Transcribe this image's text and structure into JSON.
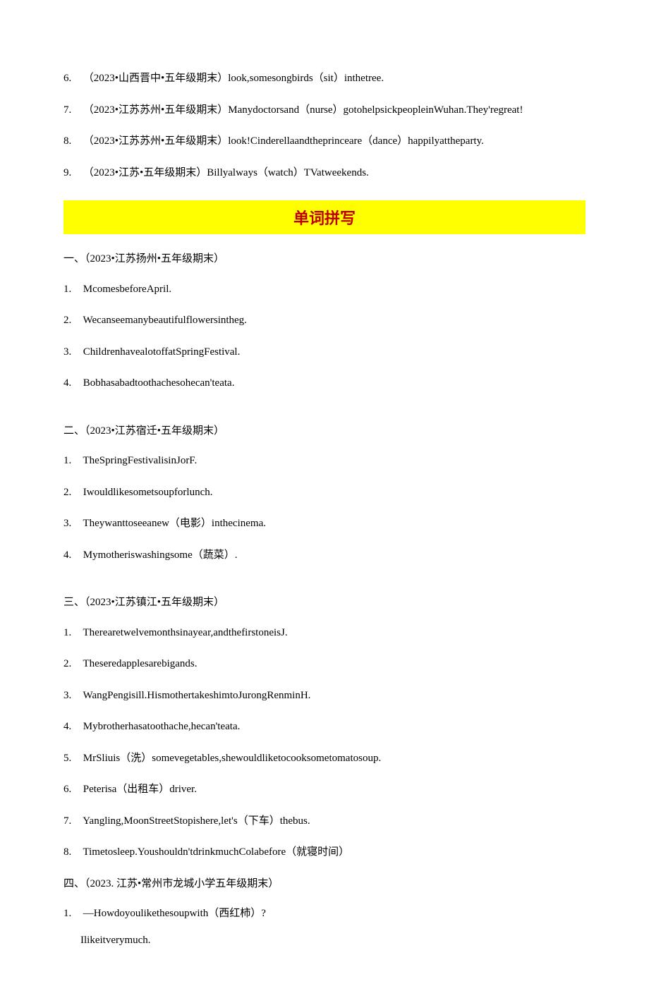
{
  "top_items": [
    {
      "num": "6.",
      "text": "（2023•山西晋中•五年级期末）look,somesongbirds（sit）inthetree."
    },
    {
      "num": "7.",
      "text": "（2023•江苏苏州•五年级期末）Manydoctorsand（nurse）gotohelpsickpeopleinWuhan.They'regreat!"
    },
    {
      "num": "8.",
      "text": "（2023•江苏苏州•五年级期末）look!Cinderellaandtheprinceare（dance）happilyattheparty."
    },
    {
      "num": "9.",
      "text": "（2023•江苏•五年级期末）Billyalways（watch）TVatweekends."
    }
  ],
  "banner": "单词拼写",
  "groups": [
    {
      "title": "一、（2023•江苏扬州•五年级期末）",
      "items": [
        {
          "num": "1.",
          "text": "McomesbeforeApril."
        },
        {
          "num": "2.",
          "text": "Wecanseemanybeautifulflowersintheg."
        },
        {
          "num": "3.",
          "text": "ChildrenhavealotoffatSpringFestival."
        },
        {
          "num": "4.",
          "text": "Bobhasabadtoothachesohecan'teata."
        }
      ]
    },
    {
      "title": "二、（2023•江苏宿迁•五年级期末）",
      "items": [
        {
          "num": "1.",
          "text": "TheSpringFestivalisinJorF."
        },
        {
          "num": "2.",
          "text": "Iwouldlikesometsoupforlunch."
        },
        {
          "num": "3.",
          "text": "Theywanttoseeanew（电影）inthecinema."
        },
        {
          "num": "4.",
          "text": "Mymotheriswashingsome（蔬菜）."
        }
      ]
    },
    {
      "title": "三、（2023•江苏镇江•五年级期末）",
      "items": [
        {
          "num": "1.",
          "text": "Therearetwelvemonthsinayear,andthefirstoneisJ."
        },
        {
          "num": "2.",
          "text": "Theseredapplesarebigands."
        },
        {
          "num": "3.",
          "text": "WangPengisill.HismothertakeshimtoJurongRenminH."
        },
        {
          "num": "4.",
          "text": "Mybrotherhasatoothache,hecan'teata."
        },
        {
          "num": "5.",
          "text": "MrSliuis（洗）somevegetables,shewouldliketocooksometomatosoup."
        },
        {
          "num": "6.",
          "text": "Peterisa（出租车）driver."
        },
        {
          "num": "7.",
          "text": "Yangling,MoonStreetStopishere,let's（下车）thebus."
        },
        {
          "num": "8.",
          "text": "Timetosleep.Youshouldn'tdrinkmuchColabefore（就寝时间）"
        }
      ]
    },
    {
      "title": "四、（2023. 江苏•常州市龙城小学五年级期末）",
      "items": [
        {
          "num": "1.",
          "text": "—Howdoyoulikethesoupwith（西红柿）?",
          "answer": "Ilikeitverymuch."
        }
      ]
    }
  ]
}
